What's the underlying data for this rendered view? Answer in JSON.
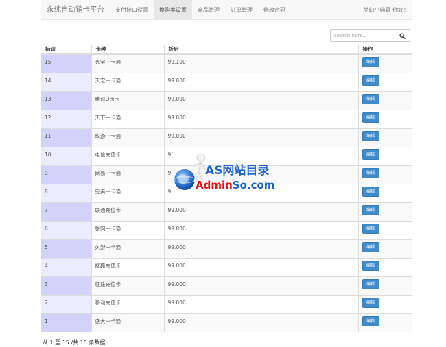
{
  "navbar": {
    "brand": "永纯自动销卡平台",
    "items": [
      {
        "label": "支付接口设置",
        "active": false
      },
      {
        "label": "换购率设置",
        "active": true
      },
      {
        "label": "商品管理",
        "active": false
      },
      {
        "label": "订单管理",
        "active": false
      },
      {
        "label": "修改密码",
        "active": false
      }
    ],
    "user_greeting": "梦幻小纯哥 你好！"
  },
  "search": {
    "placeholder": "search here..",
    "icon": "search-icon"
  },
  "table": {
    "columns": [
      "标识",
      "卡种",
      "折后",
      "操作"
    ],
    "rows": [
      {
        "id": "15",
        "card": "光宇一卡通",
        "rate": "99.100",
        "action": "编辑"
      },
      {
        "id": "14",
        "card": "天宏一卡通",
        "rate": "99.000",
        "action": "编辑"
      },
      {
        "id": "13",
        "card": "腾讯Q币卡",
        "rate": "99.000",
        "action": "编辑"
      },
      {
        "id": "12",
        "card": "天下一卡通",
        "rate": "99.000",
        "action": "编辑"
      },
      {
        "id": "11",
        "card": "纵游一卡通",
        "rate": "99.000",
        "action": "编辑"
      },
      {
        "id": "10",
        "card": "电信充值卡",
        "rate": "9(",
        "action": "编辑"
      },
      {
        "id": "9",
        "card": "网易一卡通",
        "rate": "9",
        "action": "编辑"
      },
      {
        "id": "8",
        "card": "完美一卡通",
        "rate": "9.",
        "action": "编辑"
      },
      {
        "id": "7",
        "card": "联通充值卡",
        "rate": "99.000",
        "action": "编辑"
      },
      {
        "id": "6",
        "card": "骏网一卡通",
        "rate": "99.000",
        "action": "编辑"
      },
      {
        "id": "5",
        "card": "久游一卡通",
        "rate": "99.000",
        "action": "编辑"
      },
      {
        "id": "4",
        "card": "搜狐充值卡",
        "rate": "99.000",
        "action": "编辑"
      },
      {
        "id": "3",
        "card": "征途充值卡",
        "rate": "99.000",
        "action": "编辑"
      },
      {
        "id": "2",
        "card": "移动充值卡",
        "rate": "99.000",
        "action": "编辑"
      },
      {
        "id": "1",
        "card": "盛大一卡通",
        "rate": "99.000",
        "action": "编辑"
      }
    ]
  },
  "pagination_info": "从 1 至 15 /共 15 条数据",
  "watermark": {
    "line1": "AS网站目录",
    "line2_red": "Admin",
    "line2_blue": "So.com"
  },
  "colors": {
    "primary": "#428bca",
    "id_cell_odd": "#d2d2fa",
    "id_cell_even": "#ececff",
    "watermark_blue": "#1a62c8",
    "watermark_red": "#e8111a"
  }
}
